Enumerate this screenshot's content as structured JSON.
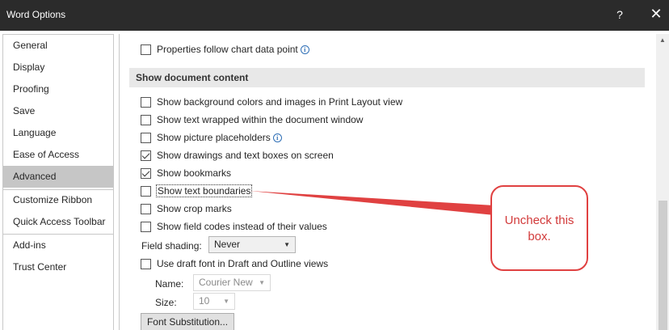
{
  "window": {
    "title": "Word Options",
    "help_label": "?",
    "close_label": "✕"
  },
  "sidebar": {
    "items": [
      {
        "label": "General"
      },
      {
        "label": "Display"
      },
      {
        "label": "Proofing"
      },
      {
        "label": "Save"
      },
      {
        "label": "Language"
      },
      {
        "label": "Ease of Access"
      },
      {
        "label": "Advanced",
        "selected": true
      },
      {
        "label": "Customize Ribbon"
      },
      {
        "label": "Quick Access Toolbar"
      },
      {
        "label": "Add-ins"
      },
      {
        "label": "Trust Center"
      }
    ]
  },
  "content": {
    "top_option": {
      "label": "Properties follow chart data point",
      "checked": false
    },
    "section_title": "Show document content",
    "options": [
      {
        "label": "Show background colors and images in Print Layout view",
        "checked": false
      },
      {
        "label": "Show text wrapped within the document window",
        "checked": false
      },
      {
        "label": "Show picture placeholders",
        "checked": false
      },
      {
        "label": "Show drawings and text boxes on screen",
        "checked": true
      },
      {
        "label": "Show bookmarks",
        "checked": true
      },
      {
        "label": "Show text boundaries",
        "checked": false
      },
      {
        "label": "Show crop marks",
        "checked": false
      },
      {
        "label": "Show field codes instead of their values",
        "checked": false
      }
    ],
    "field_shading": {
      "label": "Field shading:",
      "value": "Never"
    },
    "draft_font": {
      "label": "Use draft font in Draft and Outline views",
      "checked": false
    },
    "name_field": {
      "label": "Name:",
      "value": "Courier New"
    },
    "size_field": {
      "label": "Size:",
      "value": "10"
    },
    "font_substitution_button": "Font Substitution..."
  },
  "scrollbar": {
    "up_arrow": "▲"
  },
  "callout": {
    "line1": "Uncheck this",
    "line2": "box.",
    "color": "#e04141"
  },
  "icons": {
    "info": "i",
    "dropdown": "▼"
  }
}
